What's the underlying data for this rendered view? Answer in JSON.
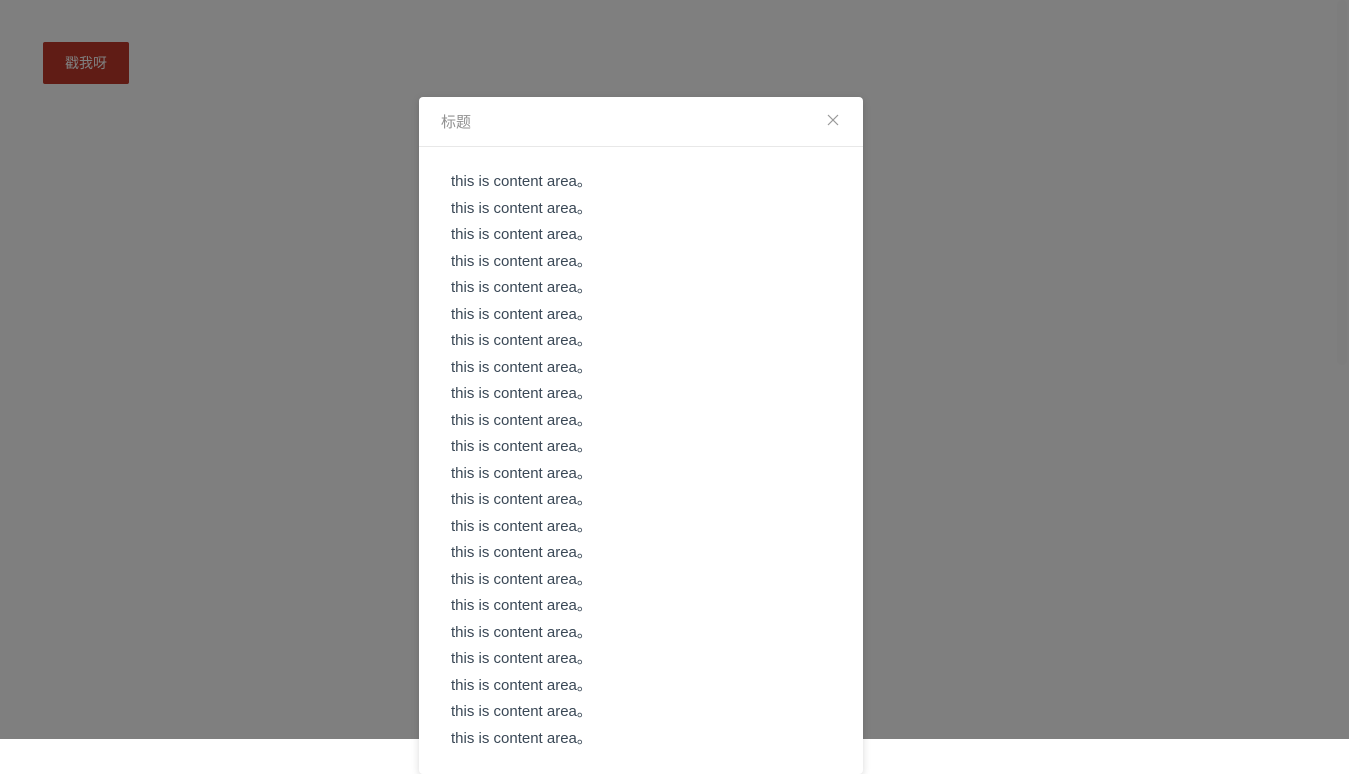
{
  "trigger": {
    "label": "戳我呀"
  },
  "dialog": {
    "title": "标题",
    "content_line": "this is content area。",
    "content_count": 22
  }
}
